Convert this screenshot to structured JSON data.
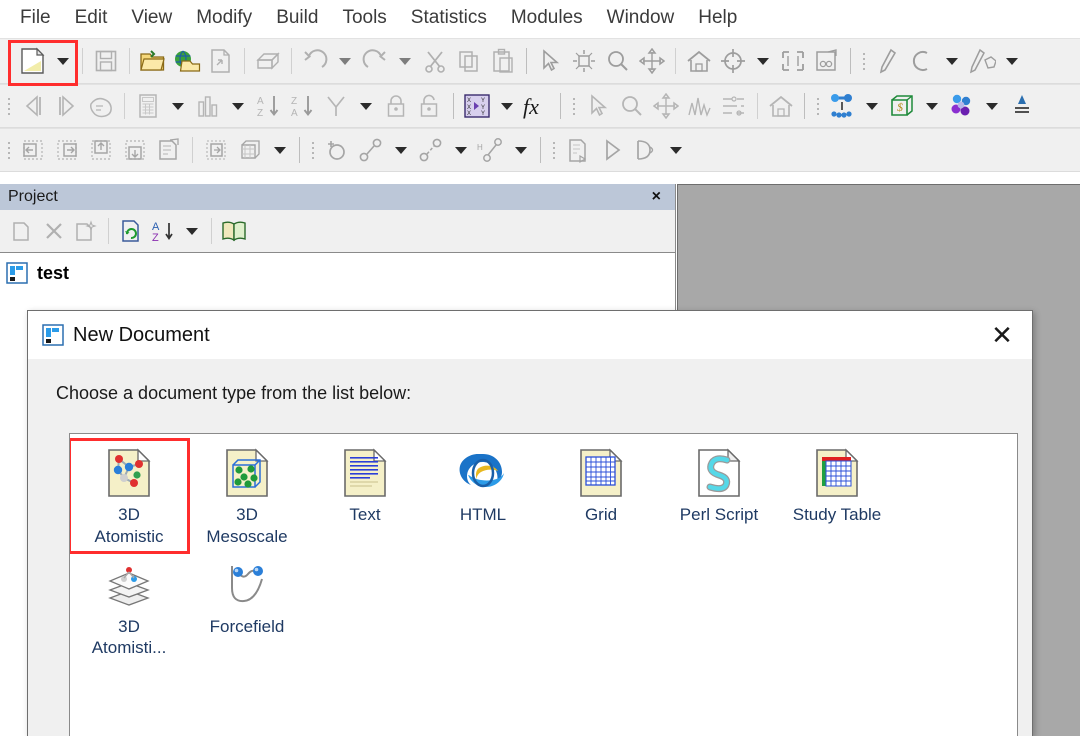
{
  "menubar": {
    "items": [
      {
        "label": "File"
      },
      {
        "label": "Edit"
      },
      {
        "label": "View"
      },
      {
        "label": "Modify"
      },
      {
        "label": "Build"
      },
      {
        "label": "Tools"
      },
      {
        "label": "Statistics"
      },
      {
        "label": "Modules"
      },
      {
        "label": "Window"
      },
      {
        "label": "Help"
      }
    ]
  },
  "toolbars": {
    "row1": [
      {
        "icon": "new-document-icon",
        "highlighted": true
      },
      {
        "icon": "new-document-dropdown-caret"
      },
      {
        "icon": "save-icon"
      },
      {
        "icon": "open-project-icon"
      },
      {
        "icon": "import-web-icon"
      },
      {
        "icon": "export-icon"
      },
      {
        "icon": "print-icon"
      },
      {
        "icon": "undo-icon"
      },
      {
        "icon": "undo-dropdown-caret"
      },
      {
        "icon": "redo-icon"
      },
      {
        "icon": "redo-dropdown-caret"
      },
      {
        "icon": "cut-icon"
      },
      {
        "icon": "copy-icon"
      },
      {
        "icon": "paste-icon"
      },
      {
        "icon": "select-arrow-icon"
      },
      {
        "icon": "rotate-icon"
      },
      {
        "icon": "zoom-icon"
      },
      {
        "icon": "pan-icon"
      },
      {
        "icon": "home-view-icon"
      },
      {
        "icon": "center-target-icon"
      },
      {
        "icon": "center-dropdown-caret"
      },
      {
        "icon": "fit-to-screen-icon"
      },
      {
        "icon": "display-style-icon"
      },
      {
        "icon": "pencil-icon"
      },
      {
        "icon": "arc-icon"
      },
      {
        "icon": "arc-dropdown-caret"
      },
      {
        "icon": "sketch-ring-icon"
      }
    ],
    "row2": [
      {
        "icon": "previous-frame-icon"
      },
      {
        "icon": "next-frame-icon"
      },
      {
        "icon": "pointer-hand-icon"
      },
      {
        "icon": "calculator-icon"
      },
      {
        "icon": "calculator-dropdown-caret"
      },
      {
        "icon": "chart-icon"
      },
      {
        "icon": "chart-dropdown-caret"
      },
      {
        "icon": "sort-ascending-icon"
      },
      {
        "icon": "sort-descending-icon"
      },
      {
        "icon": "filter-icon"
      },
      {
        "icon": "filter-dropdown-caret"
      },
      {
        "icon": "lock-icon"
      },
      {
        "icon": "unlock-icon"
      },
      {
        "icon": "xy-data-icon"
      },
      {
        "icon": "xy-data-dropdown-caret"
      },
      {
        "icon": "function-fx-icon"
      },
      {
        "icon": "select-arrow-icon"
      },
      {
        "icon": "zoom-icon"
      },
      {
        "icon": "pan-icon"
      },
      {
        "icon": "spectrum-icon"
      },
      {
        "icon": "hierarchy-icon"
      },
      {
        "icon": "home-view-icon"
      },
      {
        "icon": "bond-tool-icon"
      },
      {
        "icon": "bond-dropdown-caret"
      },
      {
        "icon": "crystal-build-icon"
      },
      {
        "icon": "crystal-dropdown-caret"
      },
      {
        "icon": "atoms-cluster-icon"
      },
      {
        "icon": "atoms-dropdown-caret"
      },
      {
        "icon": "measure-icon"
      }
    ],
    "row3": [
      {
        "icon": "insert-left-icon"
      },
      {
        "icon": "insert-right-icon"
      },
      {
        "icon": "insert-above-icon"
      },
      {
        "icon": "insert-below-icon"
      },
      {
        "icon": "properties-icon"
      },
      {
        "icon": "cell-edit-icon"
      },
      {
        "icon": "supercell-icon"
      },
      {
        "icon": "supercell-dropdown-caret"
      },
      {
        "icon": "add-atom-icon"
      },
      {
        "icon": "bond-length-icon"
      },
      {
        "icon": "bond-length-dropdown-caret"
      },
      {
        "icon": "bond-angle-icon"
      },
      {
        "icon": "bond-angle-dropdown-caret"
      },
      {
        "icon": "torsion-icon"
      },
      {
        "icon": "torsion-dropdown-caret"
      },
      {
        "icon": "script-run-icon"
      },
      {
        "icon": "play-icon"
      },
      {
        "icon": "animation-icon"
      },
      {
        "icon": "animation-dropdown-caret"
      }
    ]
  },
  "project": {
    "title": "Project",
    "close_label": "×",
    "toolbar": [
      {
        "icon": "new-folder-icon"
      },
      {
        "icon": "delete-icon"
      },
      {
        "icon": "new-item-icon"
      },
      {
        "icon": "refresh-icon"
      },
      {
        "icon": "sort-az-icon"
      },
      {
        "icon": "sort-dropdown-caret"
      },
      {
        "icon": "library-book-icon"
      }
    ],
    "tree": [
      {
        "label": "test",
        "icon": "project-icon"
      }
    ]
  },
  "dialog": {
    "title": "New Document",
    "title_icon": "project-icon",
    "close_label": "✕",
    "prompt": "Choose a document type from the list below:",
    "items": [
      {
        "label": "3D\nAtomistic",
        "icon": "atomistic-document-icon",
        "selected": true
      },
      {
        "label": "3D\nMesoscale",
        "icon": "mesoscale-document-icon",
        "selected": false
      },
      {
        "label": "Text",
        "icon": "text-document-icon",
        "selected": false
      },
      {
        "label": "HTML",
        "icon": "html-document-icon",
        "selected": false
      },
      {
        "label": "Grid",
        "icon": "grid-document-icon",
        "selected": false
      },
      {
        "label": "Perl Script",
        "icon": "perl-script-document-icon",
        "selected": false
      },
      {
        "label": "Study Table",
        "icon": "study-table-document-icon",
        "selected": false
      },
      {
        "label": "3D\nAtomisti...",
        "icon": "atomistic-collection-icon",
        "selected": false
      },
      {
        "label": "Forcefield",
        "icon": "forcefield-document-icon",
        "selected": false
      }
    ]
  },
  "colors": {
    "accent_red": "#ff2d2d",
    "title_bar": "#bcc7d8",
    "toolbar_bg": "#f0f0f0",
    "mdi_bg": "#a8a8a8",
    "label_blue": "#1f3a63"
  }
}
